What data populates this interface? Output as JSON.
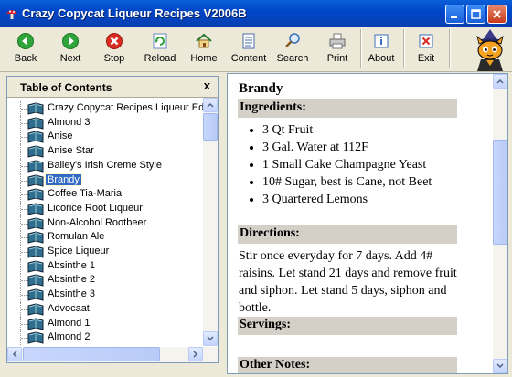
{
  "window": {
    "title": "Crazy Copycat Liqueur Recipes V2006B"
  },
  "toolbar": {
    "back": "Back",
    "next": "Next",
    "stop": "Stop",
    "reload": "Reload",
    "home": "Home",
    "content": "Content",
    "search": "Search",
    "print": "Print",
    "about": "About",
    "exit": "Exit"
  },
  "toc": {
    "title": "Table of Contents",
    "close": "x",
    "items": [
      "Crazy Copycat Recipes Liqueur Edition",
      "Almond 3",
      "Anise",
      "Anise Star",
      "Bailey's Irish Creme Style",
      "Brandy",
      "Coffee Tia-Maria",
      "Licorice Root  Liqueur",
      "Non-Alcohol Rootbeer",
      "Romulan Ale",
      "Spice Liqueur",
      "Absinthe 1",
      "Absinthe 2",
      "Absinthe 3",
      "Advocaat",
      "Almond 1",
      "Almond 2"
    ],
    "selected_index": 5
  },
  "recipe": {
    "title": "Brandy",
    "ingredients_header": "Ingredients:",
    "ingredients": [
      "3 Qt Fruit",
      "3 Gal. Water at 112F",
      "1 Small Cake Champagne Yeast",
      "10# Sugar, best is Cane, not Beet",
      "3 Quartered Lemons"
    ],
    "directions_header": "Directions:",
    "directions": "Stir once everyday for 7 days. Add 4# raisins. Let stand 21 days and remove fruit and siphon. Let stand 5 days, siphon and bottle.",
    "servings_header": "Servings:",
    "notes_header": "Other Notes:"
  },
  "colors": {
    "title_bar": "#0A4FD0",
    "selection": "#316AC5",
    "section_bg": "#D4D0C8"
  }
}
